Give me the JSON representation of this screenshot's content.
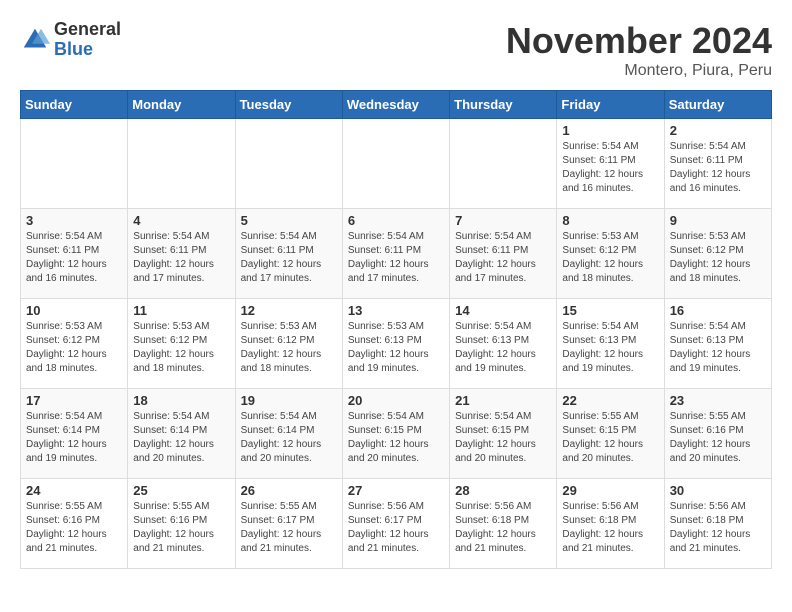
{
  "header": {
    "logo_general": "General",
    "logo_blue": "Blue",
    "month_title": "November 2024",
    "subtitle": "Montero, Piura, Peru"
  },
  "days_of_week": [
    "Sunday",
    "Monday",
    "Tuesday",
    "Wednesday",
    "Thursday",
    "Friday",
    "Saturday"
  ],
  "weeks": [
    [
      {
        "day": "",
        "info": ""
      },
      {
        "day": "",
        "info": ""
      },
      {
        "day": "",
        "info": ""
      },
      {
        "day": "",
        "info": ""
      },
      {
        "day": "",
        "info": ""
      },
      {
        "day": "1",
        "info": "Sunrise: 5:54 AM\nSunset: 6:11 PM\nDaylight: 12 hours and 16 minutes."
      },
      {
        "day": "2",
        "info": "Sunrise: 5:54 AM\nSunset: 6:11 PM\nDaylight: 12 hours and 16 minutes."
      }
    ],
    [
      {
        "day": "3",
        "info": "Sunrise: 5:54 AM\nSunset: 6:11 PM\nDaylight: 12 hours and 16 minutes."
      },
      {
        "day": "4",
        "info": "Sunrise: 5:54 AM\nSunset: 6:11 PM\nDaylight: 12 hours and 17 minutes."
      },
      {
        "day": "5",
        "info": "Sunrise: 5:54 AM\nSunset: 6:11 PM\nDaylight: 12 hours and 17 minutes."
      },
      {
        "day": "6",
        "info": "Sunrise: 5:54 AM\nSunset: 6:11 PM\nDaylight: 12 hours and 17 minutes."
      },
      {
        "day": "7",
        "info": "Sunrise: 5:54 AM\nSunset: 6:11 PM\nDaylight: 12 hours and 17 minutes."
      },
      {
        "day": "8",
        "info": "Sunrise: 5:53 AM\nSunset: 6:12 PM\nDaylight: 12 hours and 18 minutes."
      },
      {
        "day": "9",
        "info": "Sunrise: 5:53 AM\nSunset: 6:12 PM\nDaylight: 12 hours and 18 minutes."
      }
    ],
    [
      {
        "day": "10",
        "info": "Sunrise: 5:53 AM\nSunset: 6:12 PM\nDaylight: 12 hours and 18 minutes."
      },
      {
        "day": "11",
        "info": "Sunrise: 5:53 AM\nSunset: 6:12 PM\nDaylight: 12 hours and 18 minutes."
      },
      {
        "day": "12",
        "info": "Sunrise: 5:53 AM\nSunset: 6:12 PM\nDaylight: 12 hours and 18 minutes."
      },
      {
        "day": "13",
        "info": "Sunrise: 5:53 AM\nSunset: 6:13 PM\nDaylight: 12 hours and 19 minutes."
      },
      {
        "day": "14",
        "info": "Sunrise: 5:54 AM\nSunset: 6:13 PM\nDaylight: 12 hours and 19 minutes."
      },
      {
        "day": "15",
        "info": "Sunrise: 5:54 AM\nSunset: 6:13 PM\nDaylight: 12 hours and 19 minutes."
      },
      {
        "day": "16",
        "info": "Sunrise: 5:54 AM\nSunset: 6:13 PM\nDaylight: 12 hours and 19 minutes."
      }
    ],
    [
      {
        "day": "17",
        "info": "Sunrise: 5:54 AM\nSunset: 6:14 PM\nDaylight: 12 hours and 19 minutes."
      },
      {
        "day": "18",
        "info": "Sunrise: 5:54 AM\nSunset: 6:14 PM\nDaylight: 12 hours and 20 minutes."
      },
      {
        "day": "19",
        "info": "Sunrise: 5:54 AM\nSunset: 6:14 PM\nDaylight: 12 hours and 20 minutes."
      },
      {
        "day": "20",
        "info": "Sunrise: 5:54 AM\nSunset: 6:15 PM\nDaylight: 12 hours and 20 minutes."
      },
      {
        "day": "21",
        "info": "Sunrise: 5:54 AM\nSunset: 6:15 PM\nDaylight: 12 hours and 20 minutes."
      },
      {
        "day": "22",
        "info": "Sunrise: 5:55 AM\nSunset: 6:15 PM\nDaylight: 12 hours and 20 minutes."
      },
      {
        "day": "23",
        "info": "Sunrise: 5:55 AM\nSunset: 6:16 PM\nDaylight: 12 hours and 20 minutes."
      }
    ],
    [
      {
        "day": "24",
        "info": "Sunrise: 5:55 AM\nSunset: 6:16 PM\nDaylight: 12 hours and 21 minutes."
      },
      {
        "day": "25",
        "info": "Sunrise: 5:55 AM\nSunset: 6:16 PM\nDaylight: 12 hours and 21 minutes."
      },
      {
        "day": "26",
        "info": "Sunrise: 5:55 AM\nSunset: 6:17 PM\nDaylight: 12 hours and 21 minutes."
      },
      {
        "day": "27",
        "info": "Sunrise: 5:56 AM\nSunset: 6:17 PM\nDaylight: 12 hours and 21 minutes."
      },
      {
        "day": "28",
        "info": "Sunrise: 5:56 AM\nSunset: 6:18 PM\nDaylight: 12 hours and 21 minutes."
      },
      {
        "day": "29",
        "info": "Sunrise: 5:56 AM\nSunset: 6:18 PM\nDaylight: 12 hours and 21 minutes."
      },
      {
        "day": "30",
        "info": "Sunrise: 5:56 AM\nSunset: 6:18 PM\nDaylight: 12 hours and 21 minutes."
      }
    ]
  ]
}
